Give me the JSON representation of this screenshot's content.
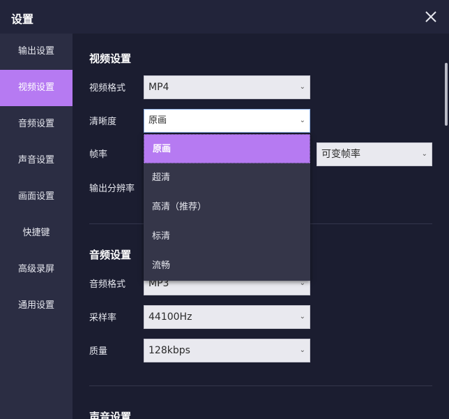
{
  "window": {
    "title": "设置"
  },
  "sidebar": {
    "items": [
      {
        "label": "输出设置"
      },
      {
        "label": "视频设置"
      },
      {
        "label": "音频设置"
      },
      {
        "label": "声音设置"
      },
      {
        "label": "画面设置"
      },
      {
        "label": "快捷键"
      },
      {
        "label": "高级录屏"
      },
      {
        "label": "通用设置"
      }
    ],
    "active_index": 1
  },
  "video": {
    "title": "视频设置",
    "format_label": "视频格式",
    "format_value": "MP4",
    "quality_label": "清晰度",
    "quality_value": "原画",
    "framerate_label": "帧率",
    "framerate_mode_value": "可变帧率",
    "resolution_label": "输出分辨率"
  },
  "audio": {
    "title": "音频设置",
    "format_label": "音频格式",
    "format_value": "MP3",
    "samplerate_label": "采样率",
    "samplerate_value": "44100Hz",
    "quality_label": "质量",
    "quality_value": "128kbps"
  },
  "sound": {
    "title": "声音设置"
  },
  "quality_dropdown": {
    "options": [
      "原画",
      "超清",
      "高清（推荐）",
      "标清",
      "流畅"
    ],
    "selected_index": 0
  },
  "colors": {
    "accent": "#b67af2",
    "sidebar_bg": "#2b2d43",
    "content_bg": "#1b1d30"
  }
}
